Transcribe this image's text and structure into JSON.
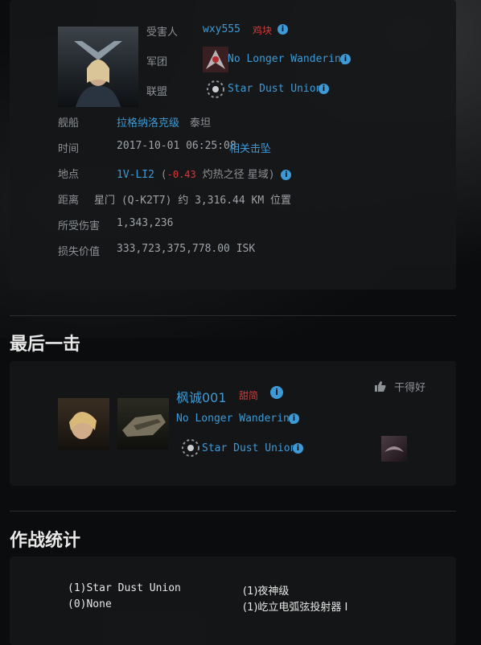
{
  "victim": {
    "fields": {
      "victim_label": "受害人",
      "victim_name": "wxy555",
      "victim_tag": "鸡块",
      "corp_label": "军团",
      "corp_name": "No Longer Wandering",
      "alliance_label": "联盟",
      "alliance_name": "Star Dust Union",
      "ship_label": "舰船",
      "ship_name": "拉格纳洛克级",
      "ship_class": "泰坦",
      "time_label": "时间",
      "time_value": "2017-10-01 06:25:08",
      "related_link": "相关击坠",
      "location_label": "地点",
      "system": "1V-LI2",
      "security": "-0.43",
      "region": "灼热之径 星域",
      "distance_label": "距离",
      "distance_value": "星门 (Q-K2T7) 约 3,316.44 KM 位置",
      "damage_label": "所受伤害",
      "damage_value": "1,343,236",
      "loss_label": "损失价值",
      "loss_value": "333,723,375,778.00 ISK"
    }
  },
  "final_blow": {
    "section_title": "最后一击",
    "pilot_name": "枫诚001",
    "pilot_tag": "甜简",
    "corp_name": "No Longer Wandering",
    "alliance_name": "Star Dust Union",
    "like_label": "干得好"
  },
  "combat_stats": {
    "section_title": "作战统计",
    "rows": [
      {
        "left": "(1)Star Dust Union",
        "right": "(1)夜神级"
      },
      {
        "left": "(0)None",
        "right": "(1)屹立电弧弦投射器 I"
      }
    ]
  },
  "icons": {
    "info": "info-icon",
    "thumb_up": "thumbs-up-icon"
  },
  "colors": {
    "link": "#3d9ad6",
    "negative": "#d23b3b",
    "panel": "#161718"
  }
}
